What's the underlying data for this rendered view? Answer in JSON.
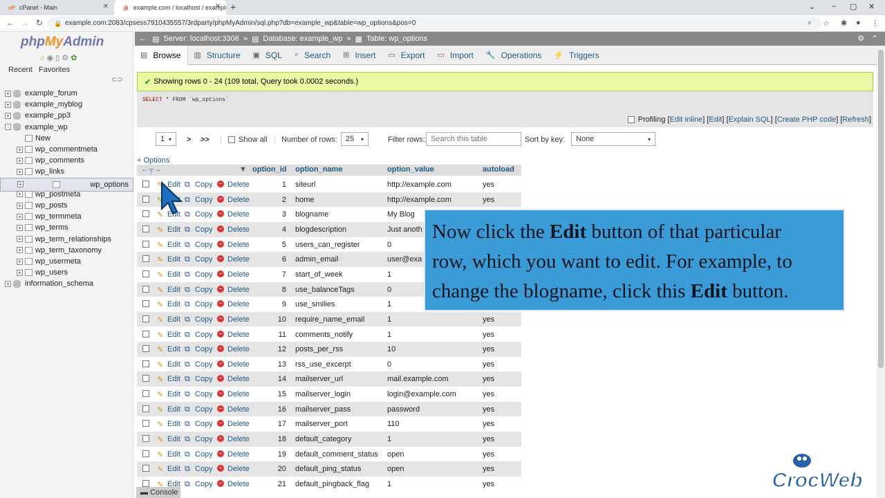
{
  "browser": {
    "tabs": [
      {
        "title": "cPanel - Main",
        "favicon": "cP"
      },
      {
        "title": "example.com / localhost / example",
        "favicon": "pma"
      }
    ],
    "url": "example.com:2083/cpsess7910435557/3rdparty/phpMyAdmin/sql.php?db=example_wp&table=wp_options&pos=0"
  },
  "sidebar": {
    "logo_php": "php",
    "logo_my": "My",
    "logo_admin": "Admin",
    "recent": "Recent",
    "favorites": "Favorites",
    "tree": [
      {
        "label": "example_forum",
        "level": 0,
        "sign": "+"
      },
      {
        "label": "example_myblog",
        "level": 0,
        "sign": "+"
      },
      {
        "label": "example_pp3",
        "level": 0,
        "sign": "+"
      },
      {
        "label": "example_wp",
        "level": 0,
        "sign": "-"
      },
      {
        "label": "New",
        "level": 1,
        "sign": ""
      },
      {
        "label": "wp_commentmeta",
        "level": 1,
        "sign": "+"
      },
      {
        "label": "wp_comments",
        "level": 1,
        "sign": "+"
      },
      {
        "label": "wp_links",
        "level": 1,
        "sign": "+"
      },
      {
        "label": "wp_options",
        "level": 1,
        "sign": "+",
        "selected": true
      },
      {
        "label": "wp_postmeta",
        "level": 1,
        "sign": "+"
      },
      {
        "label": "wp_posts",
        "level": 1,
        "sign": "+"
      },
      {
        "label": "wp_termmeta",
        "level": 1,
        "sign": "+"
      },
      {
        "label": "wp_terms",
        "level": 1,
        "sign": "+"
      },
      {
        "label": "wp_term_relationships",
        "level": 1,
        "sign": "+"
      },
      {
        "label": "wp_term_taxonomy",
        "level": 1,
        "sign": "+"
      },
      {
        "label": "wp_usermeta",
        "level": 1,
        "sign": "+"
      },
      {
        "label": "wp_users",
        "level": 1,
        "sign": "+"
      },
      {
        "label": "information_schema",
        "level": 0,
        "sign": "+"
      }
    ]
  },
  "breadcrumb": {
    "server": "Server: localhost:3306",
    "database": "Database: example_wp",
    "table": "Table: wp_options"
  },
  "tabs": [
    "Browse",
    "Structure",
    "SQL",
    "Search",
    "Insert",
    "Export",
    "Import",
    "Operations",
    "Triggers"
  ],
  "message": "Showing rows 0 - 24 (109 total, Query took 0.0002 seconds.)",
  "sql": {
    "select": "SELECT",
    "rest": " * FROM `wp_options`"
  },
  "profiling": {
    "label": "Profiling",
    "edit_inline": "Edit inline",
    "edit": "Edit",
    "explain": "Explain SQL",
    "create_php": "Create PHP code",
    "refresh": "Refresh"
  },
  "nav": {
    "page": "1",
    "next": ">",
    "last": ">>",
    "show_all": "Show all",
    "num_rows_label": "Number of rows:",
    "num_rows": "25",
    "filter_label": "Filter rows:",
    "filter_placeholder": "Search this table",
    "sort_label": "Sort by key:",
    "sort_value": "None"
  },
  "options_link": "+ Options",
  "columns": [
    "option_id",
    "option_name",
    "option_value",
    "autoload"
  ],
  "actions": {
    "edit": "Edit",
    "copy": "Copy",
    "delete": "Delete"
  },
  "rows": [
    {
      "id": "1",
      "name": "siteurl",
      "value": "http://example.com",
      "autoload": "yes"
    },
    {
      "id": "2",
      "name": "home",
      "value": "http://example.com",
      "autoload": "yes"
    },
    {
      "id": "3",
      "name": "blogname",
      "value": "My Blog",
      "autoload": ""
    },
    {
      "id": "4",
      "name": "blogdescription",
      "value": "Just anoth",
      "autoload": ""
    },
    {
      "id": "5",
      "name": "users_can_register",
      "value": "0",
      "autoload": ""
    },
    {
      "id": "6",
      "name": "admin_email",
      "value": "user@exa",
      "autoload": ""
    },
    {
      "id": "7",
      "name": "start_of_week",
      "value": "1",
      "autoload": ""
    },
    {
      "id": "8",
      "name": "use_balanceTags",
      "value": "0",
      "autoload": ""
    },
    {
      "id": "9",
      "name": "use_smilies",
      "value": "1",
      "autoload": ""
    },
    {
      "id": "10",
      "name": "require_name_email",
      "value": "1",
      "autoload": "yes"
    },
    {
      "id": "11",
      "name": "comments_notify",
      "value": "1",
      "autoload": "yes"
    },
    {
      "id": "12",
      "name": "posts_per_rss",
      "value": "10",
      "autoload": "yes"
    },
    {
      "id": "13",
      "name": "rss_use_excerpt",
      "value": "0",
      "autoload": "yes"
    },
    {
      "id": "14",
      "name": "mailserver_url",
      "value": "mail.example.com",
      "autoload": "yes"
    },
    {
      "id": "15",
      "name": "mailserver_login",
      "value": "login@example.com",
      "autoload": "yes"
    },
    {
      "id": "16",
      "name": "mailserver_pass",
      "value": "password",
      "autoload": "yes"
    },
    {
      "id": "17",
      "name": "mailserver_port",
      "value": "110",
      "autoload": "yes"
    },
    {
      "id": "18",
      "name": "default_category",
      "value": "1",
      "autoload": "yes"
    },
    {
      "id": "19",
      "name": "default_comment_status",
      "value": "open",
      "autoload": "yes"
    },
    {
      "id": "20",
      "name": "default_ping_status",
      "value": "open",
      "autoload": "yes"
    },
    {
      "id": "21",
      "name": "default_pingback_flag",
      "value": "1",
      "autoload": "yes"
    }
  ],
  "callout": {
    "line1a": "Now click the ",
    "line1b": "Edit",
    "line1c": " button of that particular",
    "line2": "row, which you want to edit. For example, to",
    "line3a": "change the blogname, click this ",
    "line3b": "Edit",
    "line3c": " button."
  },
  "console": "Console",
  "watermark": "CrocWeb",
  "colors": {
    "accent": "#235a81",
    "success_bg": "#ebf8a4",
    "callout_bg": "#3a9bd6"
  }
}
